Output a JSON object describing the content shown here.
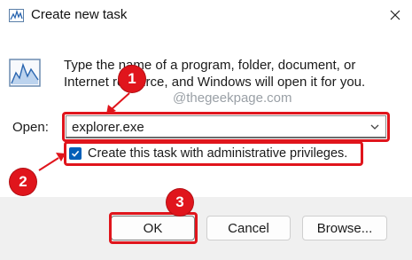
{
  "window": {
    "title": "Create new task",
    "close_glyph": "✕"
  },
  "dialog": {
    "description_line1": "Type the name of a program, folder, document, or",
    "description_line2": "Internet resource, and Windows will open it for you.",
    "open_label": "Open:",
    "open_value": "explorer.exe",
    "admin_checkbox_label": "Create this task with administrative privileges.",
    "admin_checked": true
  },
  "buttons": {
    "ok": "OK",
    "cancel": "Cancel",
    "browse": "Browse..."
  },
  "annotations": {
    "badge1": "1",
    "badge2": "2",
    "badge3": "3",
    "watermark": "@thegeekpage.com",
    "accent_color": "#e0151c"
  },
  "icons": {
    "app_icon": "task-manager-icon",
    "big_icon": "task-manager-graph-icon",
    "checkbox_icon": "checkmark-icon",
    "dropdown_icon": "chevron-down-icon"
  }
}
